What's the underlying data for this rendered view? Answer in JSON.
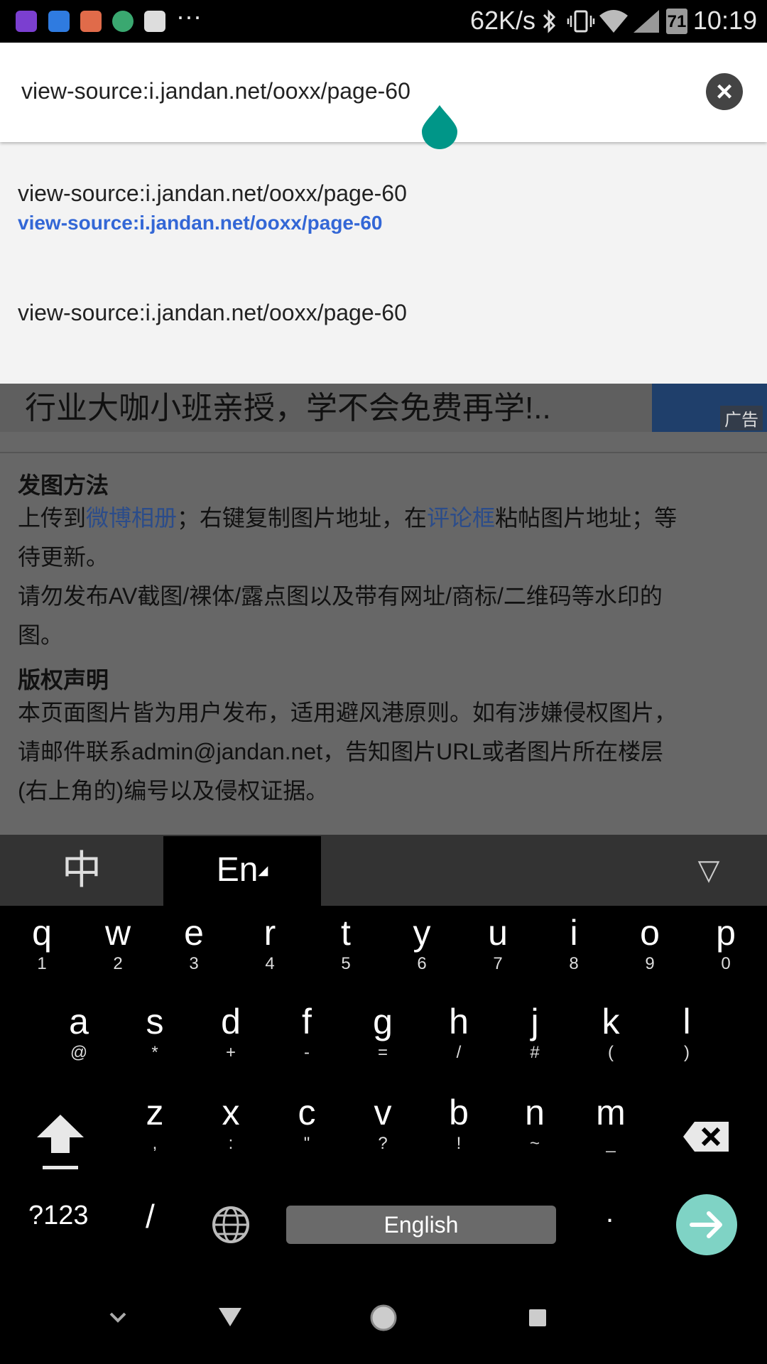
{
  "status_bar": {
    "speed": "62K/s",
    "battery": "71",
    "time": "10:19",
    "more": "···",
    "notification_icons": [
      "purple-app-icon",
      "messages-icon",
      "mail-icon",
      "maps-icon",
      "news-icon"
    ]
  },
  "url_bar": {
    "value": "view-source:i.jandan.net/ooxx/page-60"
  },
  "suggestions": [
    {
      "title": "view-source:i.jandan.net/ooxx/page-60",
      "url": "view-source:i.jandan.net/ooxx/page-60"
    },
    {
      "title": "view-source:i.jandan.net/ooxx/page-60"
    }
  ],
  "page": {
    "ad_text": "行业大咖小班亲授，学不会免费再学!..",
    "ad_label": "广告",
    "posting_heading": "发图方法",
    "posting_line1_a": "上传到",
    "posting_line1_link1": "微博相册",
    "posting_line1_b": "；右键复制图片地址，在",
    "posting_line1_link2": "评论框",
    "posting_line1_c": "粘帖图片地址；等",
    "posting_line2": "待更新。",
    "posting_line3": "请勿发布AV截图/裸体/露点图以及带有网址/商标/二维码等水印的",
    "posting_line4": "图。",
    "copyright_heading": "版权声明",
    "copyright_line1": "本页面图片皆为用户发布，适用避风港原则。如有涉嫌侵权图片，",
    "copyright_line2": "请邮件联系admin@jandan.net，告知图片URL或者图片所在楼层",
    "copyright_line3": "(右上角的)编号以及侵权证据。"
  },
  "keyboard": {
    "lang_zh": "中",
    "lang_en": "En",
    "collapse": "▽",
    "row1": [
      {
        "k": "q",
        "s": "1"
      },
      {
        "k": "w",
        "s": "2"
      },
      {
        "k": "e",
        "s": "3"
      },
      {
        "k": "r",
        "s": "4"
      },
      {
        "k": "t",
        "s": "5"
      },
      {
        "k": "y",
        "s": "6"
      },
      {
        "k": "u",
        "s": "7"
      },
      {
        "k": "i",
        "s": "8"
      },
      {
        "k": "o",
        "s": "9"
      },
      {
        "k": "p",
        "s": "0"
      }
    ],
    "row2": [
      {
        "k": "a",
        "s": "@"
      },
      {
        "k": "s",
        "s": "*"
      },
      {
        "k": "d",
        "s": "+"
      },
      {
        "k": "f",
        "s": "-"
      },
      {
        "k": "g",
        "s": "="
      },
      {
        "k": "h",
        "s": "/"
      },
      {
        "k": "j",
        "s": "#"
      },
      {
        "k": "k",
        "s": "("
      },
      {
        "k": "l",
        "s": ")"
      }
    ],
    "row3": [
      {
        "k": "z",
        "s": ","
      },
      {
        "k": "x",
        "s": ":"
      },
      {
        "k": "c",
        "s": "\""
      },
      {
        "k": "v",
        "s": "?"
      },
      {
        "k": "b",
        "s": "!"
      },
      {
        "k": "n",
        "s": "~"
      },
      {
        "k": "m",
        "s": "_"
      }
    ],
    "symbols": "?123",
    "slash": "/",
    "space": "English",
    "period": "."
  },
  "colors": {
    "accent": "#009688",
    "link": "#3367d6",
    "enter": "#7fd3c5"
  }
}
